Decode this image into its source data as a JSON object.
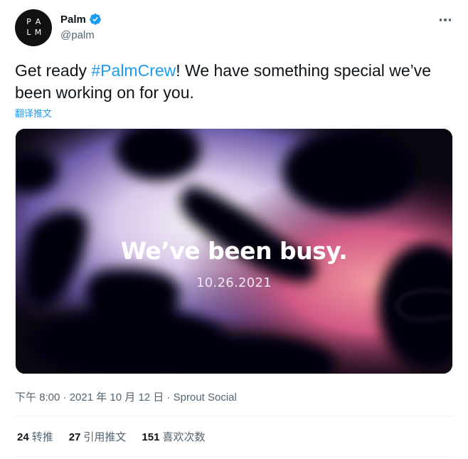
{
  "author": {
    "display_name": "Palm",
    "handle": "@palm",
    "avatar_letters": [
      "P",
      "A",
      "L",
      "M"
    ],
    "verified": true
  },
  "tweet": {
    "text_before": "Get ready ",
    "hashtag": "#PalmCrew",
    "text_after": "! We have something special we’ve been working on for you.",
    "translate_label": "翻译推文"
  },
  "media": {
    "headline": "We’ve been busy.",
    "date": "10.26.2021"
  },
  "meta": {
    "time": "下午 8:00",
    "separator": " · ",
    "date": "2021 年 10 月 12 日",
    "source": "Sprout Social"
  },
  "stats": [
    {
      "count": "24",
      "label": "转推"
    },
    {
      "count": "27",
      "label": "引用推文"
    },
    {
      "count": "151",
      "label": "喜欢次数"
    }
  ],
  "colors": {
    "accent": "#1d9bf0",
    "text": "#0f1419",
    "muted": "#536471"
  }
}
